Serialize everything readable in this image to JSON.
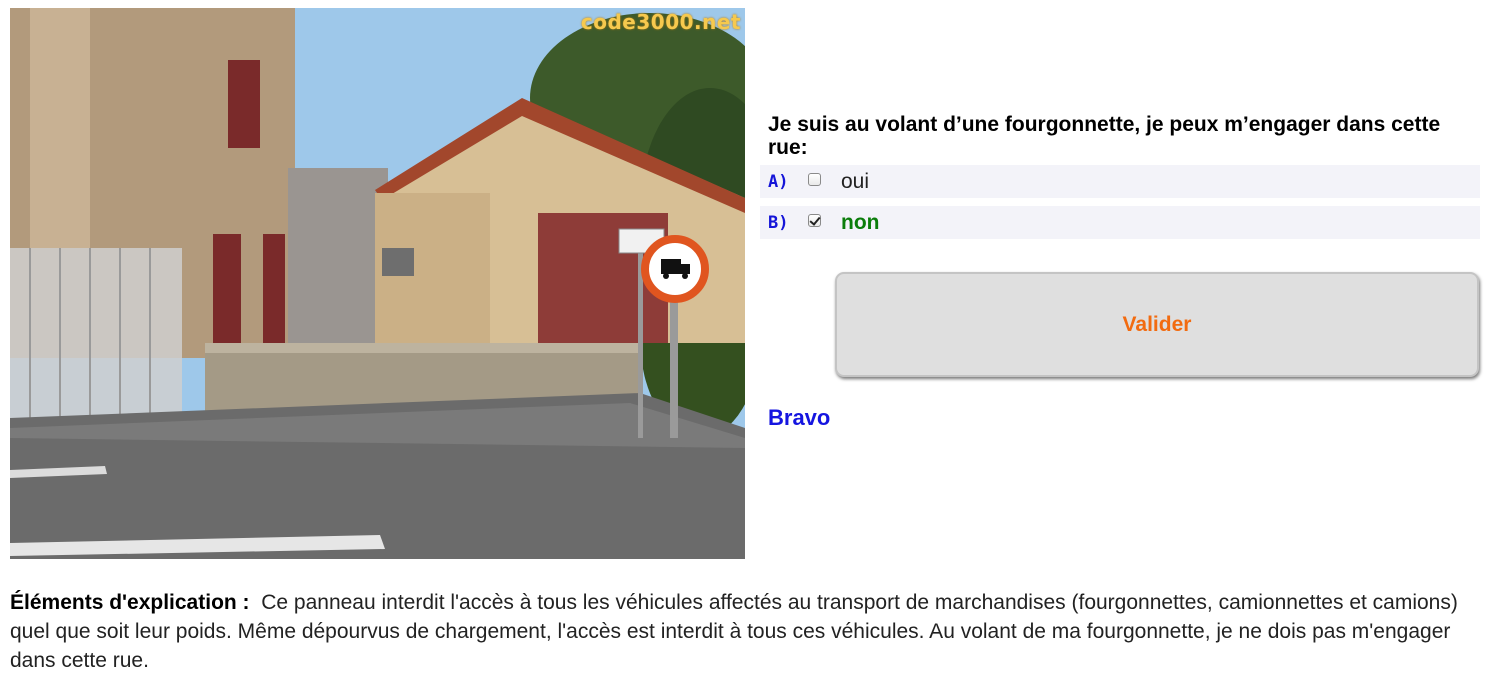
{
  "photo": {
    "watermark": "code3000.net",
    "alt": "Rue avec panneau d'interdiction d'accès aux véhicules de transport de marchandises"
  },
  "question": {
    "text": "Je suis au volant d’une fourgonnette, je peux m’engager dans cette rue:"
  },
  "answers": [
    {
      "letter": "A)",
      "text": "oui",
      "checked": false
    },
    {
      "letter": "B)",
      "text": "non",
      "checked": true
    }
  ],
  "validate_label": "Valider",
  "feedback": "Bravo",
  "explanation": {
    "lead": "Éléments d'explication :",
    "body": "Ce panneau interdit l'accès à tous les véhicules affectés au transport de marchandises (fourgonnettes, camionnettes et camions) quel que soit leur poids. Même dépourvus de chargement, l'accès est interdit à tous ces véhicules. Au volant de ma fourgonnette, je ne dois pas m'engager dans cette rue."
  },
  "colors": {
    "answer_letter": "#1515d8",
    "correct_answer": "#0b7d0b",
    "validate_text": "#f26b10",
    "feedback": "#1515e0"
  }
}
